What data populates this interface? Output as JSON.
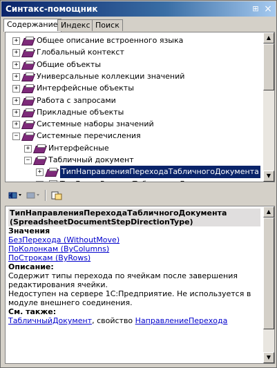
{
  "window": {
    "title": "Синтакс-помощник"
  },
  "titlebar_buttons": [
    {
      "name": "pin-icon",
      "glyph": "⊞"
    },
    {
      "name": "close-icon",
      "glyph": "×"
    }
  ],
  "tabs": [
    {
      "label": "Содержание",
      "active": true
    },
    {
      "label": "Индекс",
      "active": false
    },
    {
      "label": "Поиск",
      "active": false
    }
  ],
  "tree": {
    "items": [
      {
        "label": "Общее описание встроенного языка",
        "level": 0,
        "state": "+"
      },
      {
        "label": "Глобальный контекст",
        "level": 0,
        "state": "+"
      },
      {
        "label": "Общие объекты",
        "level": 0,
        "state": "+"
      },
      {
        "label": "Универсальные коллекции значений",
        "level": 0,
        "state": "+"
      },
      {
        "label": "Интерфейсные объекты",
        "level": 0,
        "state": "+"
      },
      {
        "label": "Работа с запросами",
        "level": 0,
        "state": "+"
      },
      {
        "label": "Прикладные объекты",
        "level": 0,
        "state": "+"
      },
      {
        "label": "Системные наборы значений",
        "level": 0,
        "state": "+"
      },
      {
        "label": "Системные перечисления",
        "level": 0,
        "state": "-"
      },
      {
        "label": "Интерфейсные",
        "level": 1,
        "state": "+"
      },
      {
        "label": "Табличный документ",
        "level": 1,
        "state": "-"
      },
      {
        "label": "ТипНаправленияПереходаТабличногоДокумента",
        "level": 2,
        "state": "+",
        "selected": true
      },
      {
        "label": "ТипЛинииРисункаТабличногоДокумента",
        "level": 2,
        "state": "+"
      }
    ]
  },
  "toolbar": {
    "back_icon": "back-arrow-icon",
    "forward_icon": "forward-arrow-icon",
    "sync_icon": "sync-tree-icon"
  },
  "article": {
    "title_line1": "ТипНаправленияПереходаТабличногоДокумента",
    "title_line2": "(SpreadsheetDocumentStepDirectionType)",
    "values_header": "Значения",
    "values": [
      "БезПерехода (WithoutMove)",
      "ПоКолонкам (ByColumns)",
      "ПоСтрокам (ByRows)"
    ],
    "description_header": "Описание:",
    "description_text": "Содержит типы перехода по ячейкам после завершения редактирования ячейки.",
    "availability_text": "Недоступен на сервере 1С:Предприятие. Не используется в модуле внешнего соединения.",
    "see_also_header": "См. также:",
    "see_also_link1": "ТабличныйДокумент",
    "see_also_mid": ", свойство ",
    "see_also_link2": "НаправлениеПерехода"
  },
  "colors": {
    "title_gradient_start": "#0a246a",
    "selection_bg": "#0a246a",
    "link": "#0000cc",
    "book_icon": "#7e2a7a"
  }
}
